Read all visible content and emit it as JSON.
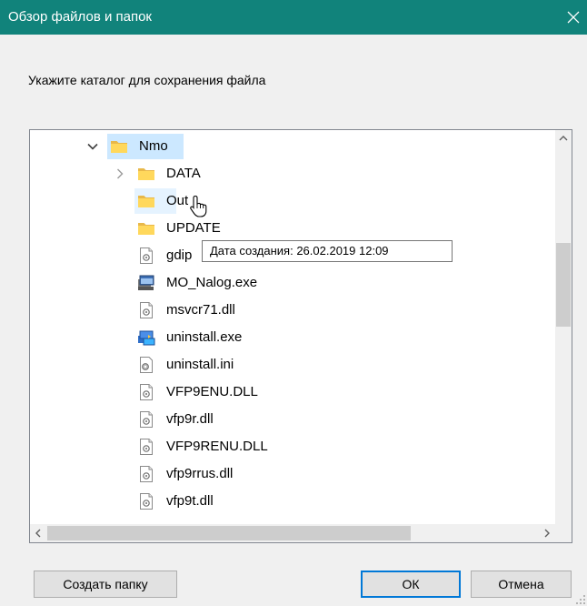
{
  "window": {
    "title": "Обзор файлов и папок"
  },
  "prompt": "Укажите каталог для сохранения файла",
  "tree": {
    "items": [
      {
        "label": "Nmo",
        "type": "folder",
        "expanded": true,
        "selected": true
      },
      {
        "label": "DATA",
        "type": "folder",
        "expanded": false
      },
      {
        "label": "Out",
        "type": "folder",
        "hovered": true
      },
      {
        "label": "UPDATE",
        "type": "folder"
      },
      {
        "label": "gdip",
        "type": "dll"
      },
      {
        "label": "MO_Nalog.exe",
        "type": "exe-app"
      },
      {
        "label": "msvcr71.dll",
        "type": "dll"
      },
      {
        "label": "uninstall.exe",
        "type": "exe-installer"
      },
      {
        "label": "uninstall.ini",
        "type": "ini"
      },
      {
        "label": "VFP9ENU.DLL",
        "type": "dll"
      },
      {
        "label": "vfp9r.dll",
        "type": "dll"
      },
      {
        "label": "VFP9RENU.DLL",
        "type": "dll"
      },
      {
        "label": "vfp9rrus.dll",
        "type": "dll"
      },
      {
        "label": "vfp9t.dll",
        "type": "dll"
      }
    ]
  },
  "tooltip": "Дата создания: 26.02.2019 12:09",
  "buttons": {
    "new_folder": "Создать папку",
    "ok": "ОК",
    "cancel": "Отмена"
  },
  "colors": {
    "titlebar": "#11837b",
    "selection": "#cce8ff",
    "hover": "#e5f3ff",
    "folder": "#ffd85c"
  }
}
